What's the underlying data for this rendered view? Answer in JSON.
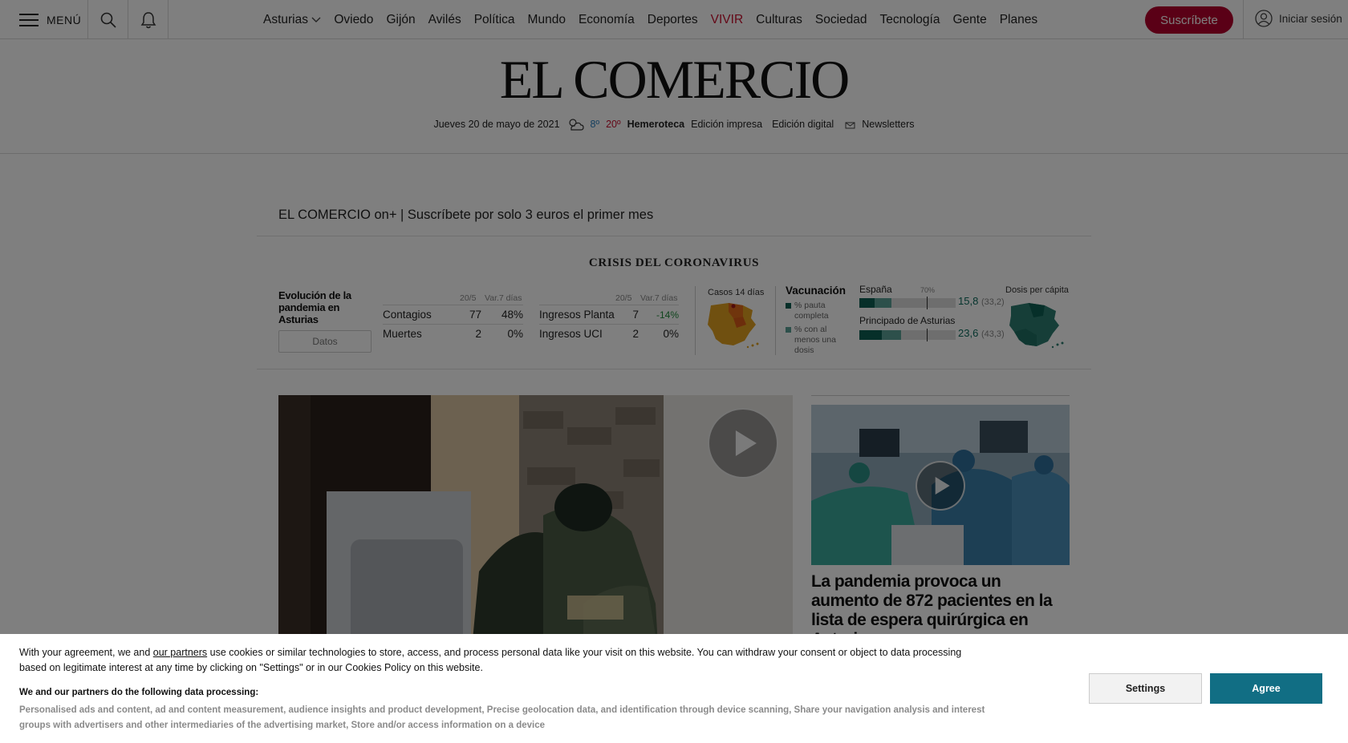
{
  "topbar": {
    "menu_label": "MENÚ",
    "nav_items": [
      "Asturias",
      "Oviedo",
      "Gijón",
      "Avilés",
      "Política",
      "Mundo",
      "Economía",
      "Deportes",
      "VIVIR",
      "Culturas",
      "Sociedad",
      "Tecnología",
      "Gente",
      "Planes"
    ],
    "subscribe_label": "Suscríbete",
    "login_label": "Iniciar sesión"
  },
  "masthead": {
    "logo": "EL COMERCIO",
    "date": "Jueves 20 de mayo de 2021",
    "temp_min": "8º",
    "temp_max": "20º",
    "links": [
      "Hemeroteca",
      "Edición impresa",
      "Edición digital",
      "Newsletters"
    ]
  },
  "promo": {
    "text": "EL COMERCIO on+ | Suscríbete por solo 3 euros el primer mes"
  },
  "covid": {
    "title": "CRISIS DEL CORONAVIRUS",
    "evolution_label": "Evolución de la pandemia en Asturias",
    "datos_button": "Datos",
    "table_left": {
      "header_date": "20/5",
      "header_var": "Var.7 días",
      "rows": [
        {
          "label": "Contagios",
          "value": "77",
          "var": "48%"
        },
        {
          "label": "Muertes",
          "value": "2",
          "var": "0%"
        }
      ]
    },
    "table_right": {
      "header_date": "20/5",
      "header_var": "Var.7 días",
      "rows": [
        {
          "label": "Ingresos Planta",
          "value": "7",
          "var": "-14%"
        },
        {
          "label": "Ingresos UCI",
          "value": "2",
          "var": "0%"
        }
      ]
    },
    "cases_map_label": "Casos 14 días",
    "vaccination": {
      "title": "Vacunación",
      "legend_full": "% pauta completa",
      "legend_one": "% con al menos una dosis",
      "marker_label": "70%",
      "per_capita_label": "Dosis per cápita",
      "regions": [
        {
          "name": "España",
          "full": 15.8,
          "one": 33.2,
          "full_text": "15,8",
          "one_text": "(33,2)"
        },
        {
          "name": "Principado de Asturias",
          "full": 23.6,
          "one": 43.3,
          "full_text": "23,6",
          "one_text": "(43,3)"
        }
      ]
    }
  },
  "side_article": {
    "headline": "La pandemia provoca un aumento de 872 pacientes en la lista de espera quirúrgica en Asturias"
  },
  "consent": {
    "text_before_link": "With your agreement, we and ",
    "link": "our partners",
    "text_after_link": " use cookies or similar technologies to store, access, and process personal data like your visit on this website. You can withdraw your consent or object to data processing based on legitimate interest at any time by clicking on \"Settings\" or in our Cookies Policy on this website.",
    "heading": "We and our partners do the following data processing:",
    "purposes": "Personalised ads and content, ad and content measurement, audience insights and product development, Precise geolocation data, and identification through device scanning, Share your navigation analysis and interest groups with advertisers and other intermediaries of the advertising market, Store and/or access information on a device",
    "settings_label": "Settings",
    "agree_label": "Agree"
  }
}
